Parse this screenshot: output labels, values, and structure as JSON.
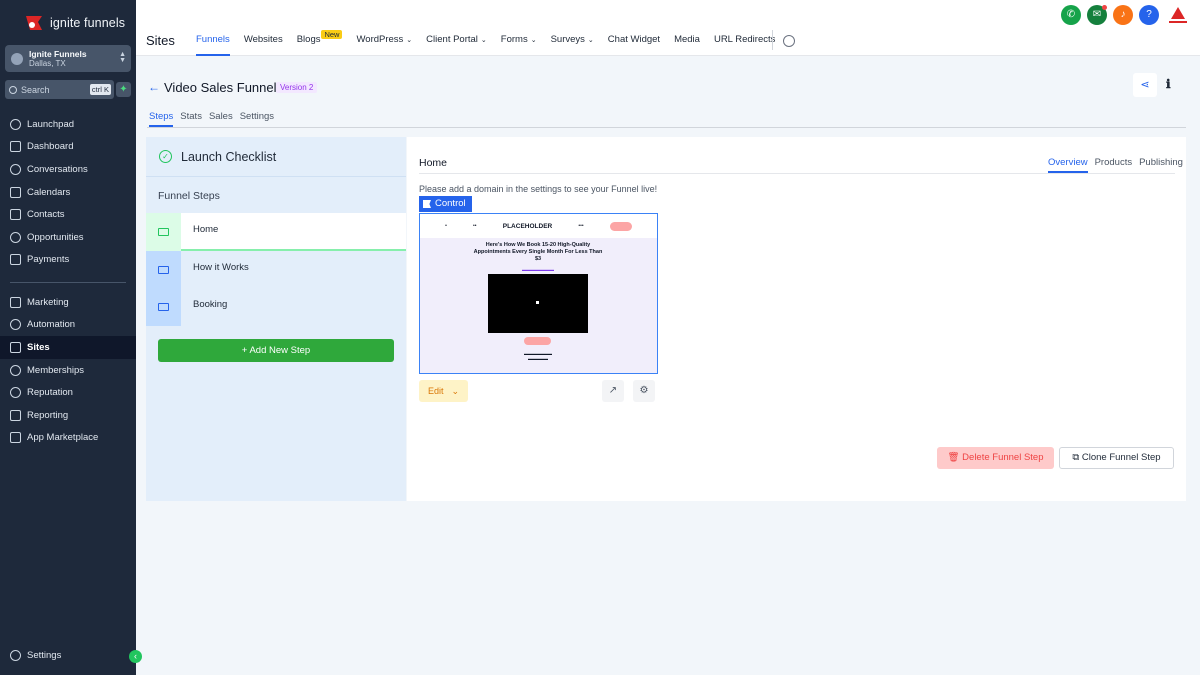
{
  "brand": {
    "name": "ignite funnels",
    "accent": "#2563eb"
  },
  "account": {
    "name": "Ignite Funnels",
    "location": "Dallas, TX"
  },
  "search": {
    "placeholder": "Search",
    "shortcut": "ctrl K"
  },
  "sidebar": {
    "items": [
      {
        "label": "Launchpad",
        "icon": "rocket-icon"
      },
      {
        "label": "Dashboard",
        "icon": "grid-icon"
      },
      {
        "label": "Conversations",
        "icon": "chat-icon"
      },
      {
        "label": "Calendars",
        "icon": "calendar-icon"
      },
      {
        "label": "Contacts",
        "icon": "contacts-icon"
      },
      {
        "label": "Opportunities",
        "icon": "opportunities-icon"
      },
      {
        "label": "Payments",
        "icon": "payments-icon"
      }
    ],
    "items2": [
      {
        "label": "Marketing",
        "icon": "send-icon"
      },
      {
        "label": "Automation",
        "icon": "automation-icon"
      },
      {
        "label": "Sites",
        "icon": "sites-icon",
        "active": true
      },
      {
        "label": "Memberships",
        "icon": "memberships-icon"
      },
      {
        "label": "Reputation",
        "icon": "star-icon"
      },
      {
        "label": "Reporting",
        "icon": "reporting-icon"
      },
      {
        "label": "App Marketplace",
        "icon": "apps-icon"
      }
    ],
    "settings": "Settings"
  },
  "topbar": {
    "title": "Sites",
    "nav": [
      {
        "label": "Funnels",
        "active": true
      },
      {
        "label": "Websites"
      },
      {
        "label": "Blogs",
        "badge": "New"
      },
      {
        "label": "WordPress",
        "dropdown": true
      },
      {
        "label": "Client Portal",
        "dropdown": true
      },
      {
        "label": "Forms",
        "dropdown": true
      },
      {
        "label": "Surveys",
        "dropdown": true
      },
      {
        "label": "Chat Widget"
      },
      {
        "label": "Media"
      },
      {
        "label": "URL Redirects"
      }
    ]
  },
  "funnel": {
    "back": "←",
    "title": "Video Sales Funnel",
    "version": "Version 2",
    "tabs": [
      "Steps",
      "Stats",
      "Sales",
      "Settings"
    ]
  },
  "checklist": {
    "title": "Launch Checklist",
    "steps_label": "Funnel Steps",
    "steps": [
      {
        "label": "Home",
        "selected": true
      },
      {
        "label": "How it Works"
      },
      {
        "label": "Booking"
      }
    ],
    "add_button": "+ Add New Step"
  },
  "detail": {
    "title": "Home",
    "tabs": [
      "Overview",
      "Products",
      "Publishing"
    ],
    "domain_note": "Please add a domain in the settings to see your Funnel live!",
    "control_label": "Control",
    "edit_label": "Edit",
    "delete_label": "Delete Funnel Step",
    "clone_label": "Clone Funnel Step",
    "preview": {
      "logo": "PLACEHOLDER",
      "headline": "Here's How We Book 15-20 High-Quality Appointments Every Single Month For Less Than $3"
    }
  }
}
